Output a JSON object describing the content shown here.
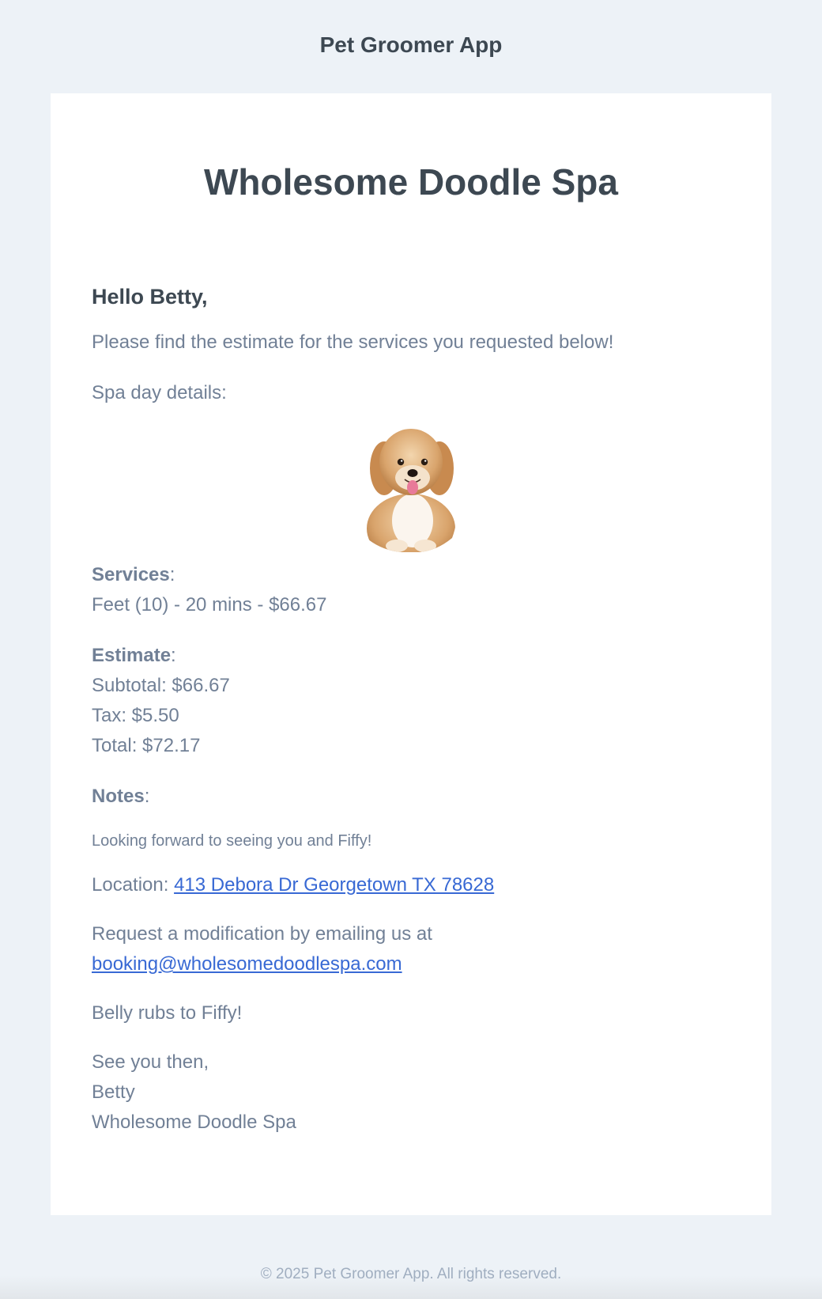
{
  "header": {
    "app_name": "Pet Groomer App"
  },
  "email": {
    "business_name": "Wholesome Doodle Spa",
    "greeting": "Hello Betty,",
    "intro": "Please find the estimate for the services you requested below!",
    "details_label": "Spa day details:",
    "pet_photo_icon": "dog-photo",
    "services": {
      "label": "Services",
      "items": [
        "Feet (10) - 20 mins - $66.67"
      ]
    },
    "estimate": {
      "label": "Estimate",
      "subtotal": "Subtotal: $66.67",
      "tax": "Tax: $5.50",
      "total": "Total: $72.17"
    },
    "notes": {
      "label": "Notes",
      "text": "Looking forward to seeing you and Fiffy!"
    },
    "location": {
      "label": "Location: ",
      "address": "413 Debora Dr Georgetown TX 78628"
    },
    "modify": {
      "text": "Request a modification by emailing us at",
      "email": "booking@wholesomedoodlespa.com"
    },
    "belly_rubs": "Belly rubs to Fiffy!",
    "signoff": {
      "closing": "See you then,",
      "name": "Betty",
      "business": "Wholesome Doodle Spa"
    }
  },
  "footer": {
    "copyright": "© 2025 Pet Groomer App. All rights reserved."
  },
  "colors": {
    "background": "#edf2f7",
    "card": "#ffffff",
    "heading": "#3d4852",
    "body_text": "#718096",
    "link": "#3869d4",
    "footer_text": "#a0aec0"
  }
}
